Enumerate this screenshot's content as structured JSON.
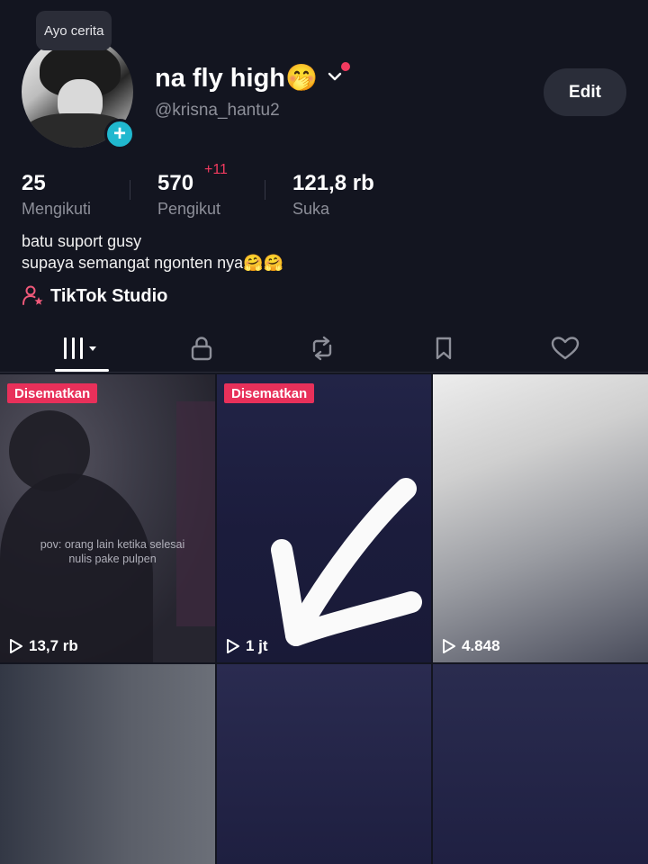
{
  "profile": {
    "story_prompt": "Ayo cerita",
    "display_name": "na fly high🤭",
    "username": "@krisna_hantu2",
    "edit_label": "Edit",
    "bio_line1": "batu suport gusy",
    "bio_line2": "supaya semangat ngonten nya🤗🤗",
    "studio_label": "TikTok Studio"
  },
  "stats": {
    "following": {
      "value": "25",
      "label": "Mengikuti"
    },
    "followers": {
      "value": "570",
      "label": "Pengikut",
      "badge": "+11"
    },
    "likes": {
      "value": "121,8 rb",
      "label": "Suka"
    }
  },
  "tabs": [
    "videos-grid-icon",
    "lock-icon",
    "repost-icon",
    "bookmark-icon",
    "heart-icon"
  ],
  "videos": [
    {
      "pinned_label": "Disematkan",
      "views": "13,7 rb",
      "caption_line1": "pov: orang lain ketika selesai",
      "caption_line2": "nulis pake pulpen"
    },
    {
      "pinned_label": "Disematkan",
      "views": "1 jt"
    },
    {
      "views": "4.848"
    }
  ],
  "colors": {
    "background": "#131520",
    "accent_pink": "#e8305a",
    "avatar_add": "#20b8cf",
    "muted_text": "#8d8f99"
  }
}
